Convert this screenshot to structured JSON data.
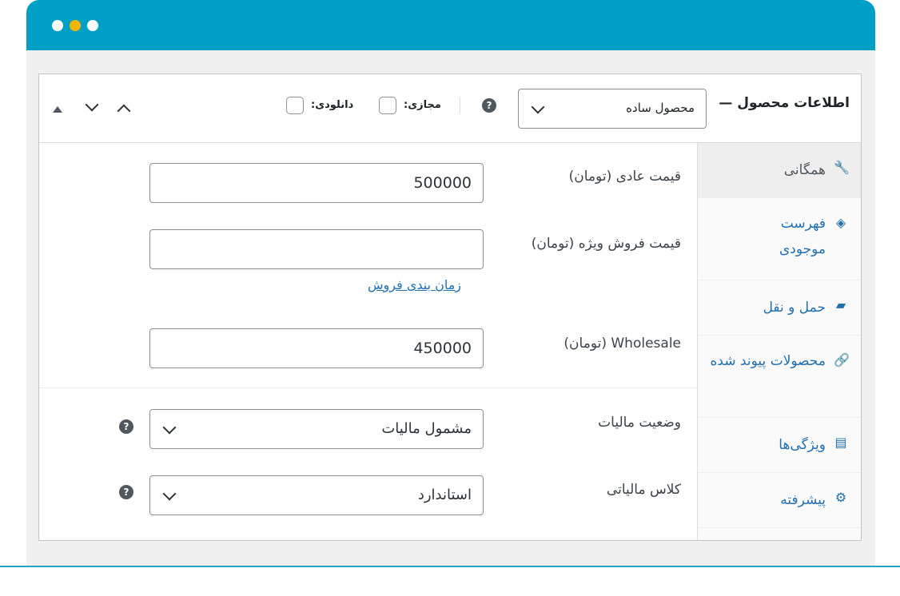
{
  "window": {
    "dots": [
      "#ffffff",
      "#f5b400",
      "#ffffff"
    ],
    "titlebar_color": "#00a0c6"
  },
  "header": {
    "title": "اطلاعات محصول —",
    "product_type": "محصول ساده",
    "virtual_label": "مجازی:",
    "downloadable_label": "دانلودی:",
    "help_icon": "?"
  },
  "sidebar": {
    "tabs": [
      {
        "label": "همگانی",
        "icon": "wrench-icon",
        "active": true
      },
      {
        "label": "فهرست موجودی",
        "icon": "tag-icon"
      },
      {
        "label": "حمل و نقل",
        "icon": "truck-icon"
      },
      {
        "label": "محصولات پیوند شده",
        "icon": "link-icon"
      },
      {
        "label": "ویژگی‌ها",
        "icon": "list-icon"
      },
      {
        "label": "پیشرفته",
        "icon": "gear-icon"
      }
    ]
  },
  "fields": {
    "regular_price": {
      "label": "قیمت عادی (تومان)",
      "value": "500000"
    },
    "sale_price": {
      "label": "قیمت فروش ویژه (تومان)",
      "value": ""
    },
    "schedule_link": "زمان بندی فروش",
    "wholesale": {
      "label": "Wholesale (تومان)",
      "value": "450000"
    },
    "tax_status": {
      "label": "وضعیت مالیات",
      "value": "مشمول مالیات"
    },
    "tax_class": {
      "label": "کلاس مالیاتی",
      "value": "استاندارد"
    }
  }
}
